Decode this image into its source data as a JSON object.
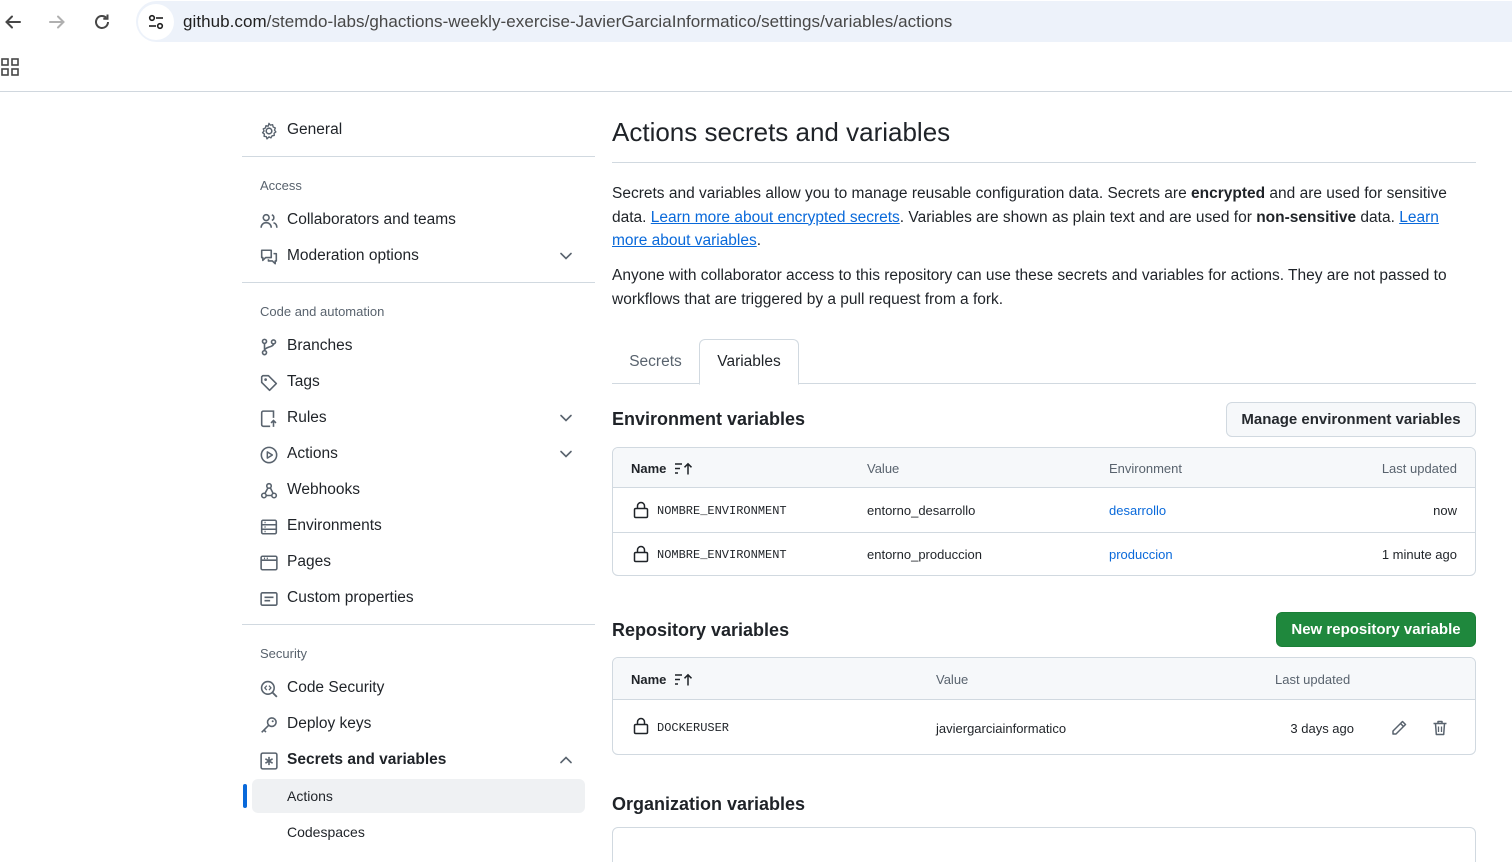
{
  "browser": {
    "url_host": "github.com",
    "url_path": "/stemdo-labs/ghactions-weekly-exercise-JavierGarciaInformatico/settings/variables/actions"
  },
  "sidebar": {
    "general": "General",
    "access_heading": "Access",
    "collaborators": "Collaborators and teams",
    "moderation": "Moderation options",
    "code_heading": "Code and automation",
    "branches": "Branches",
    "tags": "Tags",
    "rules": "Rules",
    "actions": "Actions",
    "webhooks": "Webhooks",
    "environments": "Environments",
    "pages": "Pages",
    "custom_properties": "Custom properties",
    "security_heading": "Security",
    "code_security": "Code Security",
    "deploy_keys": "Deploy keys",
    "secrets_variables": "Secrets and variables",
    "sub_actions": "Actions",
    "sub_codespaces": "Codespaces"
  },
  "main": {
    "title": "Actions secrets and variables",
    "intro": {
      "t1": "Secrets and variables allow you to manage reusable configuration data. Secrets are ",
      "b1": "encrypted",
      "t2": " and are used for sensitive data. ",
      "link1": "Learn more about encrypted secrets",
      "t3": ". Variables are shown as plain text and are used for ",
      "b2": "non-sensitive",
      "t4": " data. ",
      "link2": "Learn more about variables",
      "t5": "."
    },
    "note": "Anyone with collaborator access to this repository can use these secrets and variables for actions. They are not passed to workflows that are triggered by a pull request from a fork.",
    "tabs": [
      "Secrets",
      "Variables"
    ],
    "env_section": {
      "title": "Environment variables",
      "button": "Manage environment variables",
      "headers": {
        "name": "Name",
        "value": "Value",
        "environment": "Environment",
        "updated": "Last updated"
      },
      "rows": [
        {
          "name": "NOMBRE_ENVIRONMENT",
          "value": "entorno_desarrollo",
          "environment": "desarrollo",
          "updated": "now"
        },
        {
          "name": "NOMBRE_ENVIRONMENT",
          "value": "entorno_produccion",
          "environment": "produccion",
          "updated": "1 minute ago"
        }
      ]
    },
    "repo_section": {
      "title": "Repository variables",
      "button": "New repository variable",
      "headers": {
        "name": "Name",
        "value": "Value",
        "updated": "Last updated"
      },
      "rows": [
        {
          "name": "DOCKERUSER",
          "value": "javiergarciainformatico",
          "updated": "3 days ago"
        }
      ]
    },
    "org_section": {
      "title": "Organization variables"
    }
  }
}
